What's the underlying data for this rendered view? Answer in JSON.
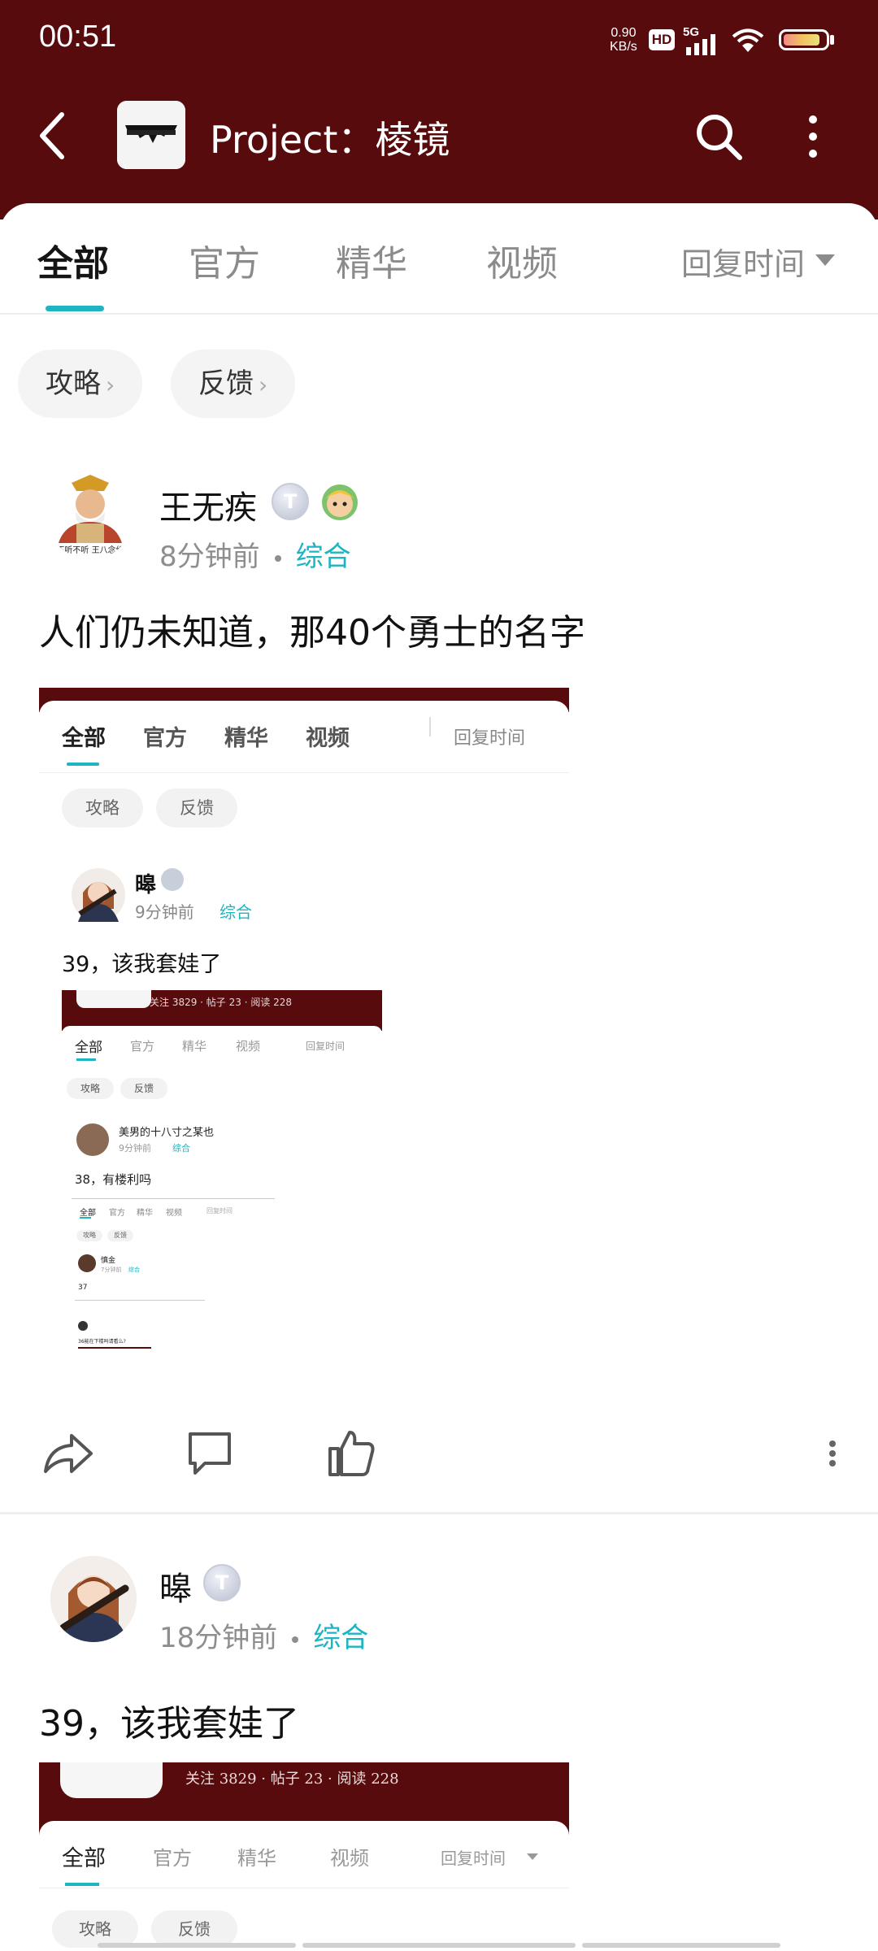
{
  "status_bar": {
    "time": "00:51",
    "net_speed_value": "0.90",
    "net_speed_unit": "KB/s",
    "hd": "HD",
    "network": "5G"
  },
  "header": {
    "title": "Project：棱镜",
    "bg_color": "#570b0c"
  },
  "tabs": [
    {
      "label": "全部",
      "active": true
    },
    {
      "label": "官方",
      "active": false
    },
    {
      "label": "精华",
      "active": false
    },
    {
      "label": "视频",
      "active": false
    }
  ],
  "sort_label": "回复时间",
  "filters": [
    {
      "label": "攻略"
    },
    {
      "label": "反馈"
    }
  ],
  "accent_color": "#1fb4c1",
  "posts": [
    {
      "author": "王无疾",
      "avatar_caption": "不听不听 王八念经",
      "badge": "T",
      "time": "8分钟前",
      "category": "综合",
      "text": "人们仍未知道，那40个勇士的名字",
      "embedded": {
        "tabs": [
          "全部",
          "官方",
          "精华",
          "视频"
        ],
        "sort": "回复时间",
        "filters": [
          "攻略",
          "反馈"
        ],
        "author": "暤",
        "time": "9分钟前",
        "category": "综合",
        "text": "39，该我套娃了",
        "nested_stats": "关注 3829 · 帖子 23 · 阅读 228",
        "nested_tabs": [
          "全部",
          "官方",
          "精华",
          "视频"
        ],
        "nested_sort": "回复时间",
        "nested_filters": [
          "攻略",
          "反馈"
        ],
        "nested_author": "美男的十八寸之某也",
        "nested_time": "9分钟前",
        "nested_category": "综合",
        "nested_text": "38，有楼利吗",
        "deep_tabs": [
          "全部",
          "官方",
          "精华",
          "视频"
        ],
        "deep_sort": "回复时间",
        "deep_filters": [
          "攻略",
          "反馈"
        ],
        "deep_author": "慎金",
        "deep_time": "7分钟前",
        "deep_category": "综合",
        "deep_text": "37",
        "deepest_text": "36能在下楼吗请看么?"
      }
    },
    {
      "author": "暤",
      "badge": "T",
      "time": "18分钟前",
      "category": "综合",
      "text": "39，该我套娃了",
      "embedded": {
        "stats": "关注 3829 · 帖子 23 · 阅读 228",
        "tabs": [
          "全部",
          "官方",
          "精华",
          "视频"
        ],
        "sort": "回复时间",
        "filters": [
          "攻略",
          "反馈"
        ]
      }
    }
  ]
}
